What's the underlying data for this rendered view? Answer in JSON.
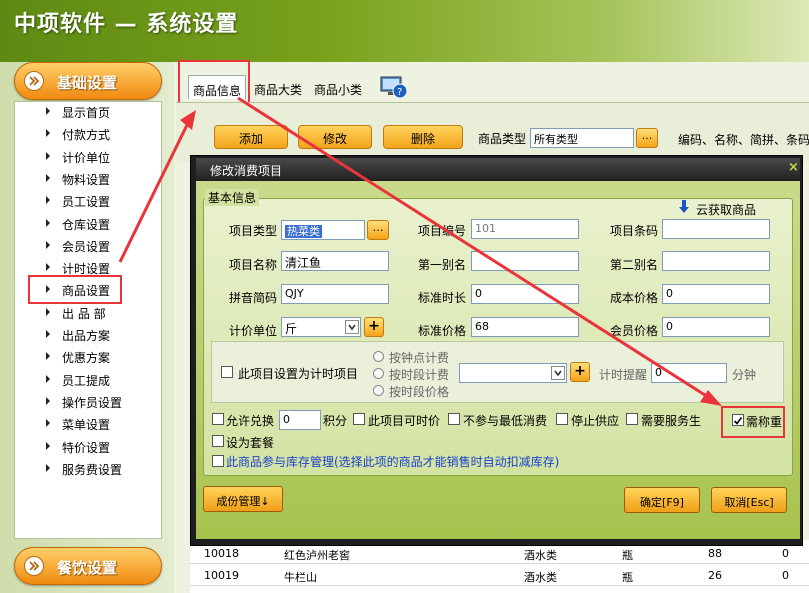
{
  "app": {
    "title": "中项软件 — 系统设置"
  },
  "sidebar": {
    "section1": "基础设置",
    "section2": "餐饮设置",
    "items": [
      "显示首页",
      "付款方式",
      "计价单位",
      "物料设置",
      "员工设置",
      "仓库设置",
      "会员设置",
      "计时设置",
      "商品设置",
      "出 品 部",
      "出品方案",
      "优惠方案",
      "员工提成",
      "操作员设置",
      "菜单设置",
      "特价设置",
      "服务费设置"
    ]
  },
  "tabs": [
    "商品信息",
    "商品大类",
    "商品小类"
  ],
  "toolbar": {
    "add": "添加",
    "edit": "修改",
    "delete": "删除",
    "type_label": "商品类型",
    "type_value": "所有类型",
    "dots": "...",
    "search_hint": "编码、名称、简拼、条码"
  },
  "dialog": {
    "title": "修改消费项目",
    "fieldset": "基本信息",
    "cloud": "云获取商品",
    "item_type_label": "项目类型",
    "item_type_value": "热菜类",
    "item_code_label": "项目编号",
    "item_code_value": "101",
    "barcode_label": "项目条码",
    "barcode_value": "",
    "name_label": "项目名称",
    "name_value": "清江鱼",
    "alias1_label": "第一别名",
    "alias1_value": "",
    "alias2_label": "第二别名",
    "alias2_value": "",
    "pinyin_label": "拼音简码",
    "pinyin_value": "QJY",
    "std_time_label": "标准时长",
    "std_time_value": "0",
    "cost_label": "成本价格",
    "cost_value": "0",
    "unit_label": "计价单位",
    "unit_value": "斤",
    "std_price_label": "标准价格",
    "std_price_value": "68",
    "member_price_label": "会员价格",
    "member_price_value": "0",
    "timed_item": "此项目设置为计时项目",
    "radio1": "按钟点计费",
    "radio2": "按时段计费",
    "radio3": "按时段价格",
    "reminder_label": "计时提醒",
    "reminder_value": "0",
    "minute": "分钟",
    "allow_exchange": "允许兑换",
    "points_value": "0",
    "points": "积分",
    "time_price": "此项目可时价",
    "no_min": "不参与最低消费",
    "stop_supply": "停止供应",
    "need_waiter": "需要服务生",
    "need_weigh": "需称重",
    "set_meal": "设为套餐",
    "stock_note": "此商品参与库存管理(选择此项的商品才能销售时自动扣减库存)",
    "btn_component": "成份管理↓",
    "btn_ok": "确定[F9]",
    "btn_cancel": "取消[Esc]"
  },
  "grid": {
    "rows": [
      {
        "code": "10018",
        "name": "红色泸州老窖",
        "cat": "酒水类",
        "unit": "瓶",
        "n1": "88",
        "n2": "0"
      },
      {
        "code": "10019",
        "name": "牛栏山",
        "cat": "酒水类",
        "unit": "瓶",
        "n1": "26",
        "n2": "0"
      }
    ]
  },
  "colors": {
    "header": "#78a21c",
    "orange": "#f5a418",
    "dialog_bg": "#b8d064",
    "highlight": "#e8343a"
  }
}
